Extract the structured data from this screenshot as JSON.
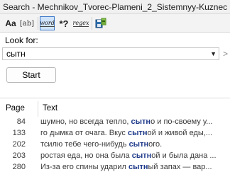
{
  "window": {
    "title": "Search - Mechnikov_Tvorec-Plameni_2_Sistemnyy-Kuznec"
  },
  "toolbar": {
    "match_case": {
      "label": "Aa",
      "icon": "match-case-icon"
    },
    "whole_text": {
      "label": "[ab]",
      "icon": "whole-text-icon"
    },
    "whole_word": {
      "label": "word",
      "icon": "whole-word-icon",
      "active": true
    },
    "wildcard": {
      "label": "*?",
      "icon": "wildcard-icon"
    },
    "regex": {
      "label": "regex",
      "icon": "regex-icon"
    },
    "save": {
      "icon": "save-results-icon"
    }
  },
  "search": {
    "label": "Look for:",
    "value": "сытн",
    "start_label": "Start"
  },
  "results": {
    "columns": [
      "Page",
      "Text"
    ],
    "rows": [
      {
        "page": "84",
        "before": "шумно, но всегда тепло, ",
        "match": "сытн",
        "after": "о и по-своему у..."
      },
      {
        "page": "133",
        "before": "го дымка от очага. Вкус ",
        "match": "сытн",
        "after": "ой и живой еды,..."
      },
      {
        "page": "202",
        "before": "тсилю тебе чего-нибудь ",
        "match": "сытн",
        "after": "ого."
      },
      {
        "page": "203",
        "before": "ростая еда, но она была ",
        "match": "сытн",
        "after": "ой и была дана ..."
      },
      {
        "page": "280",
        "before": "Из-за его спины ударил ",
        "match": "сытн",
        "after": "ый запах — вар..."
      }
    ]
  }
}
